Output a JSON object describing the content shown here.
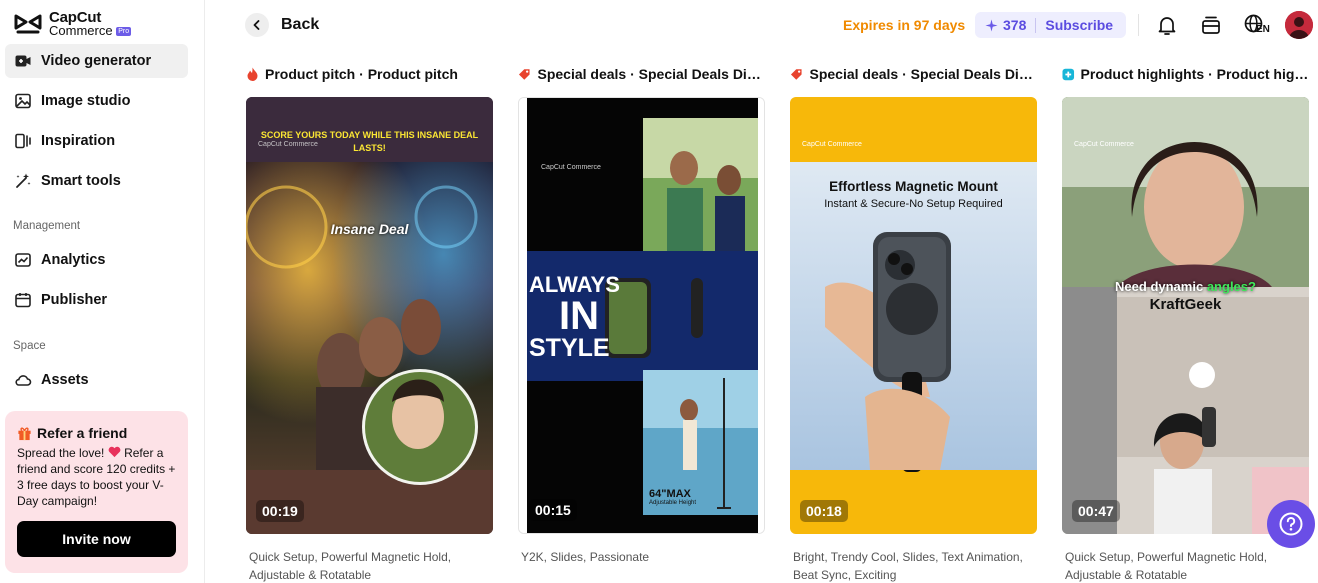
{
  "brand": {
    "name_line1": "CapCut",
    "name_line2": "Commerce",
    "badge": "Pro"
  },
  "sidebar": {
    "items": [
      {
        "label": "Video generator",
        "icon": "video-plus-icon",
        "active": true
      },
      {
        "label": "Image studio",
        "icon": "image-icon"
      },
      {
        "label": "Inspiration",
        "icon": "inspiration-icon"
      },
      {
        "label": "Smart tools",
        "icon": "magic-wand-icon"
      }
    ],
    "management_label": "Management",
    "management_items": [
      {
        "label": "Analytics",
        "icon": "chart-icon"
      },
      {
        "label": "Publisher",
        "icon": "calendar-icon"
      }
    ],
    "space_label": "Space",
    "space_items": [
      {
        "label": "Assets",
        "icon": "cloud-icon"
      }
    ]
  },
  "refer": {
    "title": "Refer a friend",
    "body_part1": "Spread the love!",
    "body_part2": "Refer a friend and score 120 credits + 3 free days to boost your V-Day campaign!",
    "button": "Invite now"
  },
  "header": {
    "back_label": "Back",
    "expires": "Expires in 97 days",
    "credits": "378",
    "subscribe": "Subscribe",
    "lang": "EN"
  },
  "cards": [
    {
      "category": "Product pitch",
      "title": "Product pitch",
      "icon_color": "#e8432e",
      "duration": "00:19",
      "tags": "Quick Setup, Powerful Magnetic Hold, Adjustable & Rotatable",
      "overlay_line1": "SCORE YOURS TODAY WHILE THIS INSANE DEAL",
      "overlay_line2": "LASTS!",
      "overlay_big": "Insane Deal",
      "watermark": "CapCut Commerce"
    },
    {
      "category": "Special deals",
      "title": "Special Deals Disp...",
      "icon_color": "#e8432e",
      "duration": "00:15",
      "tags": "Y2K, Slides, Passionate",
      "overlay_l1": "ALWAYS",
      "overlay_l2": "IN",
      "overlay_l3": "STYLE",
      "overlay_small": "64\"MAX",
      "overlay_sub": "Adjustable Height",
      "watermark": "CapCut Commerce"
    },
    {
      "category": "Special deals",
      "title": "Special Deals Disp...",
      "icon_color": "#e8432e",
      "duration": "00:18",
      "tags": "Bright, Trendy Cool, Slides, Text Animation, Beat Sync, Exciting",
      "overlay_heading": "Effortless Magnetic Mount",
      "overlay_sub": "Instant & Secure-No Setup Required",
      "watermark": "CapCut Commerce"
    },
    {
      "category": "Product highlights",
      "title": "Product highl...",
      "icon_color": "#17b6d8",
      "duration": "00:47",
      "tags": "Quick Setup, Powerful Magnetic Hold, Adjustable & Rotatable",
      "overlay_part1": "Need dynamic",
      "overlay_part2": "angles?",
      "overlay_brand": "KraftGeek",
      "watermark": "CapCut Commerce"
    }
  ]
}
